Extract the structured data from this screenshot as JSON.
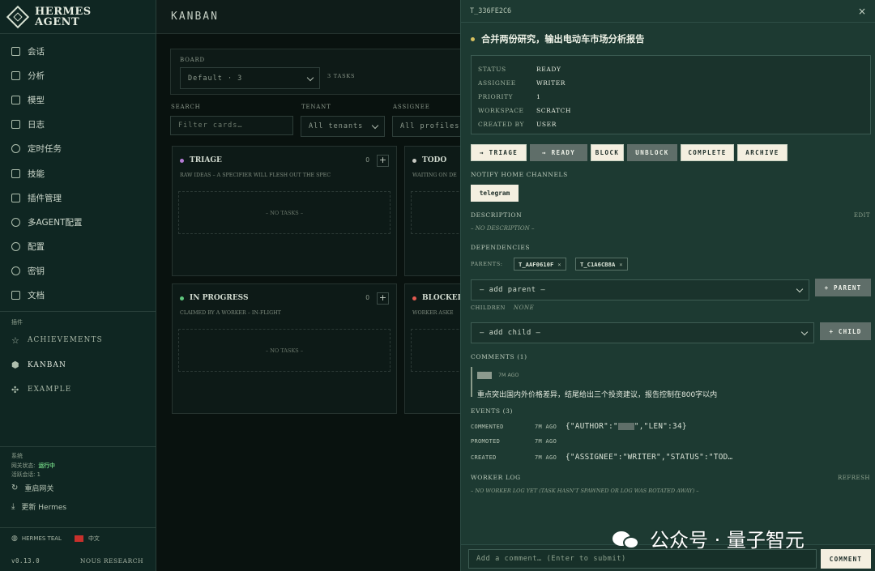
{
  "brand": {
    "line1": "HERMES",
    "line2": "AGENT"
  },
  "nav": [
    {
      "label": "会话",
      "icon": "chat-icon"
    },
    {
      "label": "分析",
      "icon": "chart-icon"
    },
    {
      "label": "模型",
      "icon": "cpu-icon"
    },
    {
      "label": "日志",
      "icon": "log-icon"
    },
    {
      "label": "定时任务",
      "icon": "clock-icon"
    },
    {
      "label": "技能",
      "icon": "cube-icon"
    },
    {
      "label": "插件管理",
      "icon": "puzzle-icon"
    },
    {
      "label": "多AGENT配置",
      "icon": "users-icon"
    },
    {
      "label": "配置",
      "icon": "gear-icon"
    },
    {
      "label": "密钥",
      "icon": "key-icon"
    },
    {
      "label": "文档",
      "icon": "book-icon"
    }
  ],
  "plugins": {
    "heading": "插件",
    "items": [
      {
        "label": "ACHIEVEMENTS",
        "icon": "star-icon"
      },
      {
        "label": "KANBAN",
        "icon": "cube-icon"
      },
      {
        "label": "EXAMPLE",
        "icon": "puzzle-icon"
      }
    ]
  },
  "system": {
    "heading": "系统",
    "gateway_label": "网关状态:",
    "gateway_value": "运行中",
    "active_label": "活跃会话: 1",
    "restart": "重启网关",
    "update": "更新 Hermes"
  },
  "footer": {
    "theme": "HERMES TEAL",
    "lang": "中文",
    "version": "v0.13.0",
    "org": "NOUS RESEARCH"
  },
  "main": {
    "title": "KANBAN",
    "board_label": "BOARD",
    "board_value": "Default · 3",
    "task_count": "3 TASKS",
    "search_label": "SEARCH",
    "search_placeholder": "Filter cards…",
    "tenant_label": "TENANT",
    "tenant_value": "All tenants",
    "assignee_label": "ASSIGNEE",
    "assignee_value": "All profiles",
    "columns": [
      {
        "name": "TRIAGE",
        "desc": "RAW IDEAS – A SPECIFIER WILL FLESH OUT THE SPEC",
        "count": "0",
        "empty": "– NO TASKS –",
        "color": "#b57bd6"
      },
      {
        "name": "TODO",
        "desc": "WAITING ON DE",
        "count": "",
        "empty": "",
        "color": "#c7c9c2"
      },
      {
        "name": "IN PROGRESS",
        "desc": "CLAIMED BY A WORKER – IN-FLIGHT",
        "count": "0",
        "empty": "– NO TASKS –",
        "color": "#5fc67d"
      },
      {
        "name": "BLOCKED",
        "desc": "WORKER ASKE",
        "count": "",
        "empty": "",
        "color": "#e25a50"
      }
    ]
  },
  "panel": {
    "task_id": "T_336FE2C6",
    "title": "合并两份研究，输出电动车市场分析报告",
    "meta": [
      {
        "key": "STATUS",
        "value": "READY"
      },
      {
        "key": "ASSIGNEE",
        "value": "WRITER"
      },
      {
        "key": "PRIORITY",
        "value": "1"
      },
      {
        "key": "WORKSPACE",
        "value": "SCRATCH"
      },
      {
        "key": "CREATED BY",
        "value": "USER"
      }
    ],
    "actions": [
      "→ TRIAGE",
      "→ READY",
      "BLOCK",
      "UNBLOCK",
      "COMPLETE",
      "ARCHIVE"
    ],
    "notify_label": "NOTIFY HOME CHANNELS",
    "notify_chip": "telegram",
    "description_label": "DESCRIPTION",
    "edit_label": "EDIT",
    "no_description": "– NO DESCRIPTION –",
    "dependencies_label": "DEPENDENCIES",
    "parents_label": "PARENTS:",
    "parents": [
      "T_AAF0610F",
      "T_C1A6CB8A"
    ],
    "add_parent": "— add parent —",
    "parent_btn": "+ PARENT",
    "children_label": "CHILDREN",
    "children_value": "NONE",
    "add_child": "— add child —",
    "child_btn": "+ CHILD",
    "comments_label": "COMMENTS (1)",
    "comment_time": "7M AGO",
    "comment_body": "重点突出国内外价格差异，结尾给出三个投资建议，报告控制在800字以内",
    "events_label": "EVENTS (3)",
    "events": [
      {
        "kind": "COMMENTED",
        "time": "7M AGO",
        "p1": "{\"AUTHOR\":\"",
        "p2": "\",\"LEN\":34}"
      },
      {
        "kind": "PROMOTED",
        "time": "7M AGO",
        "p1": "",
        "p2": ""
      },
      {
        "kind": "CREATED",
        "time": "7M AGO",
        "p1": "{\"ASSIGNEE\":\"WRITER\",\"STATUS\":\"TOD…",
        "p2": ""
      }
    ],
    "worker_log_label": "WORKER LOG",
    "refresh_label": "REFRESH",
    "worker_log_empty": "– NO WORKER LOG YET (TASK HASN'T SPAWNED OR LOG WAS ROTATED AWAY) –",
    "comment_placeholder": "Add a comment… (Enter to submit)",
    "comment_btn": "COMMENT"
  },
  "watermark": "公众号 · 量子智元"
}
